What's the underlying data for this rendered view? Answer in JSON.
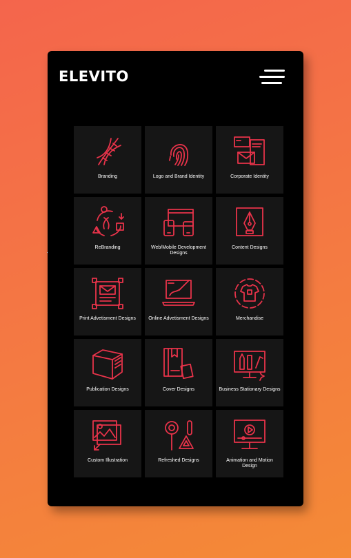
{
  "brand": {
    "logo": "ELEVITO"
  },
  "menu": {
    "icon": "hamburger-icon"
  },
  "colors": {
    "accent": "#e8334a",
    "background": "#000000",
    "tile": "#161616"
  },
  "services": [
    {
      "label": "Branding",
      "icon": "dna-icon"
    },
    {
      "label": "Logo and Brand Identity",
      "icon": "fingerprint-icon"
    },
    {
      "label": "Corporate Identity",
      "icon": "stationery-icon"
    },
    {
      "label": "ReBranding",
      "icon": "rebrand-cycle-icon"
    },
    {
      "label": "Web/Mobile Development Designs",
      "icon": "devices-icon"
    },
    {
      "label": "Content Designs",
      "icon": "pen-nib-icon"
    },
    {
      "label": "Print Advetisment Designs",
      "icon": "print-layout-icon"
    },
    {
      "label": "Online Advetisment Designs",
      "icon": "laptop-drawing-icon"
    },
    {
      "label": "Merchandise",
      "icon": "tshirt-icon"
    },
    {
      "label": "Publication Designs",
      "icon": "book-icon"
    },
    {
      "label": "Cover Designs",
      "icon": "cover-book-icon"
    },
    {
      "label": "Business Stationary Designs",
      "icon": "monitor-tools-icon"
    },
    {
      "label": "Custom Illustration",
      "icon": "image-frame-icon"
    },
    {
      "label": "Refreshed Designs",
      "icon": "design-tools-icon"
    },
    {
      "label": "Animation and Motion Design",
      "icon": "video-monitor-icon"
    }
  ]
}
